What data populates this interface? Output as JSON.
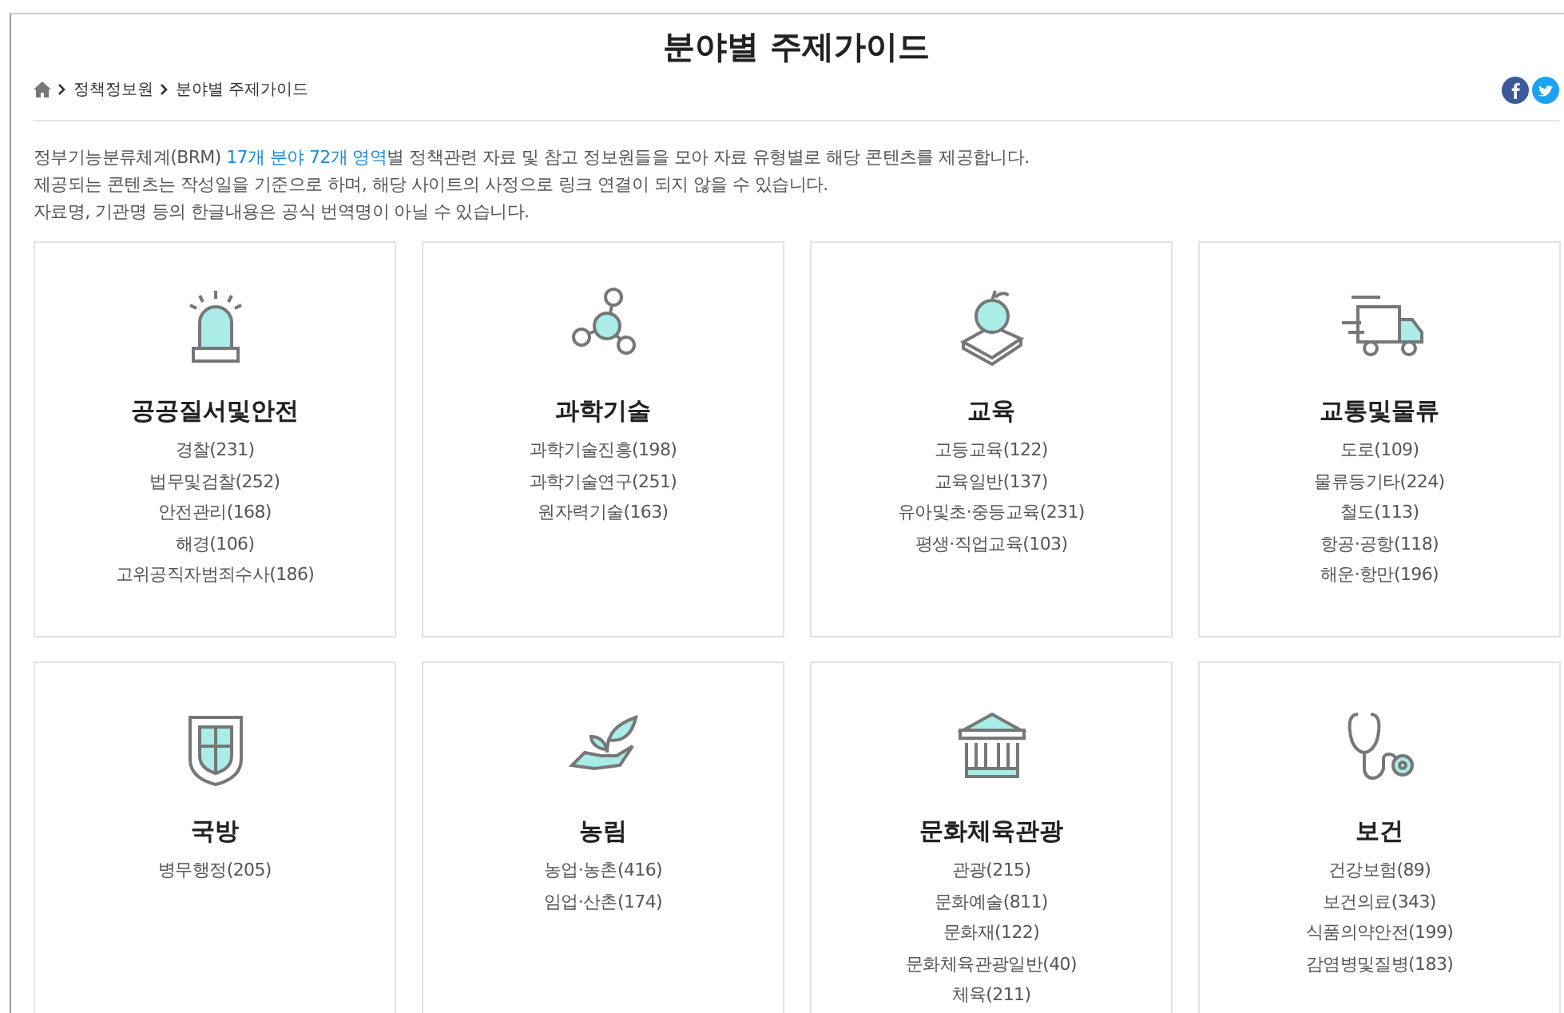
{
  "page_title": "분야별 주제가이드",
  "breadcrumb": [
    "정책정보원",
    "분야별 주제가이드"
  ],
  "intro": [
    [
      {
        "text": "정부기능분류체계(BRM) ",
        "highlighted": false
      },
      {
        "text": "17개 분야 72개 영역",
        "highlighted": true
      },
      {
        "text": "별 정책관련 자료 및 참고 정보원들을 모아 자료 유형별로 해당 콘텐츠를 제공합니다.",
        "highlighted": false
      }
    ],
    [
      {
        "text": "제공되는 콘텐츠는 작성일을 기준으로 하며, 해당 사이트의 사정으로 링크 연결이 되지 않을 수 있습니다.",
        "highlighted": false
      }
    ],
    [
      {
        "text": "자료명, 기관명 등의 한글내용은 공식 번역명이 아닐 수 있습니다.",
        "highlighted": false
      }
    ]
  ],
  "cards": [
    {
      "title": "공공질서및안전",
      "items": [
        "경찰(231)",
        "법무및검찰(252)",
        "안전관리(168)",
        "해경(106)",
        "고위공직자범죄수사(186)"
      ]
    },
    {
      "title": "과학기술",
      "items": [
        "과학기술진흥(198)",
        "과학기술연구(251)",
        "원자력기술(163)"
      ]
    },
    {
      "title": "교육",
      "items": [
        "고등교육(122)",
        "교육일반(137)",
        "유아및초·중등교육(231)",
        "평생·직업교육(103)"
      ]
    },
    {
      "title": "교통및물류",
      "items": [
        "도로(109)",
        "물류등기타(224)",
        "철도(113)",
        "항공·공항(118)",
        "해운·항만(196)"
      ]
    },
    {
      "title": "국방",
      "items": [
        "병무행정(205)"
      ]
    },
    {
      "title": "농림",
      "items": [
        "농업·농촌(416)",
        "임업·산촌(174)"
      ]
    },
    {
      "title": "문화체육관광",
      "items": [
        "관광(215)",
        "문화예술(811)",
        "문화재(122)",
        "문화체육관광일반(40)",
        "체육(211)"
      ]
    },
    {
      "title": "보건",
      "items": [
        "건강보험(89)",
        "보건의료(343)",
        "식품의약안전(199)",
        "감염병및질병(183)"
      ]
    }
  ]
}
